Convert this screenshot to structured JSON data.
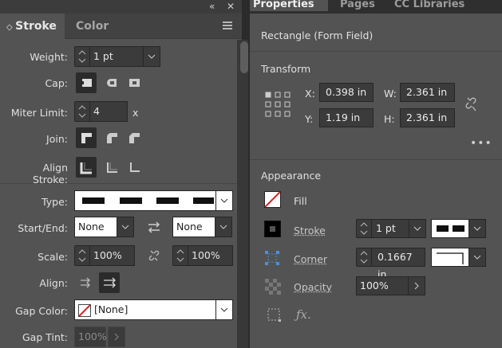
{
  "stroke_panel": {
    "tabs": [
      "Stroke",
      "Color"
    ],
    "weight": {
      "label": "Weight:",
      "value": "1 pt"
    },
    "cap_label": "Cap:",
    "miter": {
      "label": "Miter Limit:",
      "value": "4",
      "suffix": "x"
    },
    "join_label": "Join:",
    "align_stroke_label": "Align Stroke:",
    "type_label": "Type:",
    "start_end": {
      "label": "Start/End:",
      "start": "None",
      "end": "None"
    },
    "scale": {
      "label": "Scale:",
      "start": "100%",
      "end": "100%"
    },
    "align_label": "Align:",
    "gap_color": {
      "label": "Gap Color:",
      "value": "[None]"
    },
    "gap_tint": {
      "label": "Gap Tint:",
      "value": "100%"
    }
  },
  "properties_panel": {
    "tabs": [
      "Properties",
      "Pages",
      "CC Libraries"
    ],
    "object_type": "Rectangle (Form Field)",
    "transform": {
      "title": "Transform",
      "x_label": "X:",
      "x": "0.398 in",
      "y_label": "Y:",
      "y": "1.19 in",
      "w_label": "W:",
      "w": "2.361 in",
      "h_label": "H:",
      "h": "2.361 in"
    },
    "appearance": {
      "title": "Appearance",
      "fill_label": "Fill",
      "stroke_label": "Stroke",
      "stroke_weight": "1 pt",
      "corner_label": "Corner",
      "corner_value": "0.1667 in",
      "opacity_label": "Opacity",
      "opacity_value": "100%"
    }
  },
  "colors": {
    "panel": "#535353",
    "field": "#3b3b3b",
    "none_red": "#e01e1e",
    "accent_blue": "#4a90d9"
  }
}
